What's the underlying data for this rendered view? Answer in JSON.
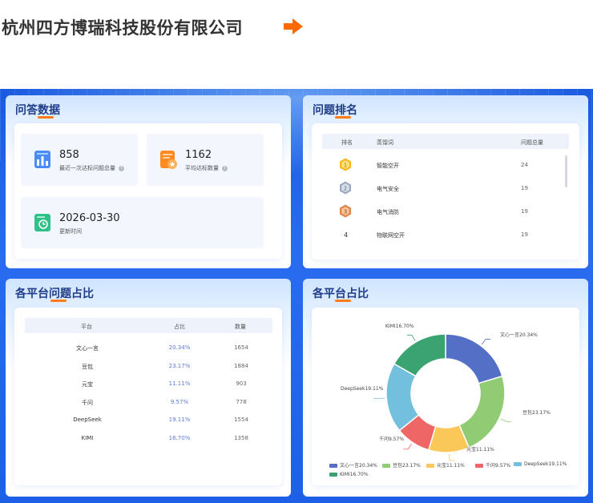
{
  "header": {
    "company": "杭州四方博瑞科技股份有限公司"
  },
  "qa": {
    "title": "问答数据",
    "stats": [
      {
        "value": "858",
        "label": "最近一次达标问题总量"
      },
      {
        "value": "1162",
        "label": "平均达标数量"
      },
      {
        "value": "2026-03-30",
        "label": "更新时间"
      }
    ]
  },
  "ranking": {
    "title": "问题排名",
    "columns": [
      "排名",
      "蒸馏词",
      "问题总量"
    ],
    "rows": [
      {
        "rank": "1",
        "word": "智能空开",
        "total": "24"
      },
      {
        "rank": "2",
        "word": "电气安全",
        "total": "19"
      },
      {
        "rank": "3",
        "word": "电气消防",
        "total": "19"
      },
      {
        "rank": "4",
        "word": "物联网空开",
        "total": "19"
      }
    ]
  },
  "platform_table": {
    "title": "各平台问题占比",
    "columns": [
      "平台",
      "占比",
      "数量"
    ],
    "rows": [
      {
        "platform": "文心一言",
        "ratio": "20.34%",
        "count": "1654"
      },
      {
        "platform": "豆包",
        "ratio": "23.17%",
        "count": "1884"
      },
      {
        "platform": "元宝",
        "ratio": "11.11%",
        "count": "903"
      },
      {
        "platform": "千问",
        "ratio": "9.57%",
        "count": "778"
      },
      {
        "platform": "DeepSeek",
        "ratio": "19.11%",
        "count": "1554"
      },
      {
        "platform": "KIMI",
        "ratio": "16.70%",
        "count": "1358"
      }
    ]
  },
  "platform_chart": {
    "title": "各平台占比",
    "chart_data": {
      "type": "pie",
      "categories": [
        "文心一言",
        "豆包",
        "元宝",
        "千问",
        "DeepSeek",
        "KIMI"
      ],
      "values": [
        20.34,
        23.17,
        11.11,
        9.57,
        19.11,
        16.7
      ],
      "labels": [
        "文心一言20.34%",
        "豆包23.17%",
        "元宝11.11%",
        "千问9.57%",
        "DeepSeek19.11%",
        "KIMI16.70%"
      ],
      "colors": [
        "#5470c6",
        "#91cc75",
        "#fac858",
        "#ee6666",
        "#73c0de",
        "#3ba272"
      ],
      "legend": "bottom"
    }
  },
  "colors": {
    "accent": "#ff7a1a",
    "title": "#1f3d8a",
    "background": "#1d5fe6"
  },
  "icons": [
    "arrow-right-icon",
    "report-icon",
    "document-star-icon",
    "update-icon",
    "rank-medal-icon",
    "info-icon"
  ]
}
